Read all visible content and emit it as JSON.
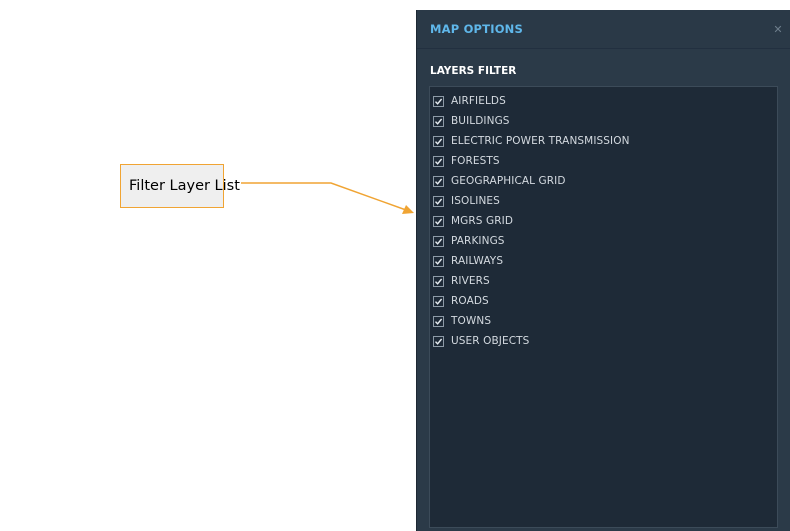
{
  "callout": {
    "label": "Filter Layer List",
    "color": "#f0a433"
  },
  "panel": {
    "title": "MAP OPTIONS",
    "close_icon": "close-icon",
    "section_title": "LAYERS FILTER",
    "title_color": "#5fb7ea",
    "layers": [
      {
        "label": "AIRFIELDS",
        "checked": true
      },
      {
        "label": "BUILDINGS",
        "checked": true
      },
      {
        "label": "ELECTRIC POWER TRANSMISSION",
        "checked": true
      },
      {
        "label": "FORESTS",
        "checked": true
      },
      {
        "label": "GEOGRAPHICAL GRID",
        "checked": true
      },
      {
        "label": "ISOLINES",
        "checked": true
      },
      {
        "label": "MGRS GRID",
        "checked": true
      },
      {
        "label": "PARKINGS",
        "checked": true
      },
      {
        "label": "RAILWAYS",
        "checked": true
      },
      {
        "label": "RIVERS",
        "checked": true
      },
      {
        "label": "ROADS",
        "checked": true
      },
      {
        "label": "TOWNS",
        "checked": true
      },
      {
        "label": "USER OBJECTS",
        "checked": true
      }
    ]
  }
}
